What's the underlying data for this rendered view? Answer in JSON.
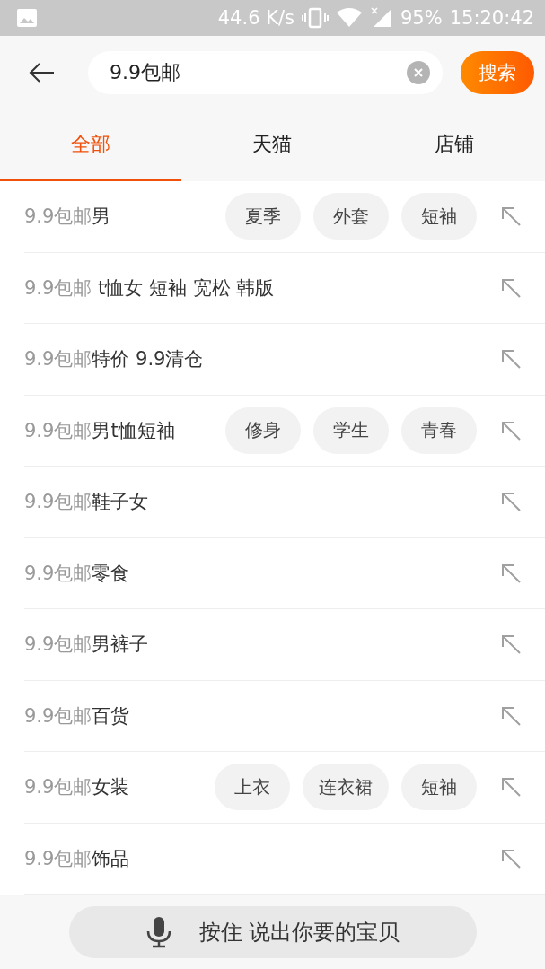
{
  "status_bar": {
    "speed": "44.6 K/s",
    "battery": "95%",
    "time": "15:20:42"
  },
  "search": {
    "value": "9.9包邮",
    "button": "搜索"
  },
  "tabs": [
    {
      "label": "全部",
      "selected": true
    },
    {
      "label": "天猫",
      "selected": false
    },
    {
      "label": "店铺",
      "selected": false
    }
  ],
  "suggestions": [
    {
      "prefix": "9.9包邮",
      "rest": "男",
      "tags": [
        "夏季",
        "外套",
        "短袖"
      ]
    },
    {
      "prefix": "9.9包邮",
      "rest": " t恤女 短袖 宽松 韩版"
    },
    {
      "prefix": "9.9包邮",
      "rest": "特价 9.9清仓"
    },
    {
      "prefix": "9.9包邮",
      "rest": "男t恤短袖",
      "tags": [
        "修身",
        "学生",
        "青春"
      ]
    },
    {
      "prefix": "9.9包邮",
      "rest": "鞋子女"
    },
    {
      "prefix": "9.9包邮",
      "rest": "零食"
    },
    {
      "prefix": "9.9包邮",
      "rest": "男裤子"
    },
    {
      "prefix": "9.9包邮",
      "rest": "百货"
    },
    {
      "prefix": "9.9包邮",
      "rest": "女装",
      "tags": [
        "上衣",
        "连衣裙",
        "短袖"
      ]
    },
    {
      "prefix": "9.9包邮",
      "rest": "饰品"
    }
  ],
  "voice_button": "按住 说出你要的宝贝"
}
